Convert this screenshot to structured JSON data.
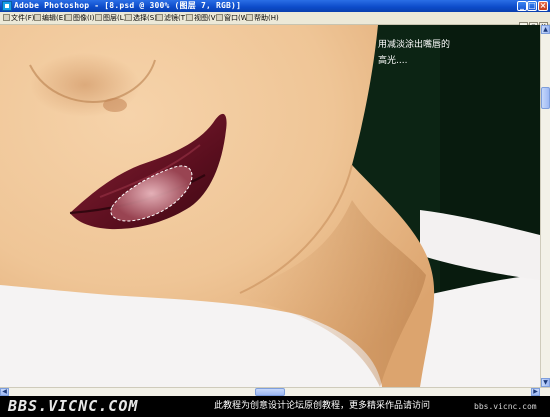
{
  "window": {
    "title": "Adobe Photoshop - [8.psd @ 300% (图层 7, RGB)]",
    "app_icon": "photoshop-icon",
    "controls": [
      "minimize",
      "maximize",
      "close"
    ]
  },
  "menubar": {
    "items": [
      {
        "label": "文件(F)"
      },
      {
        "label": "编辑(E)"
      },
      {
        "label": "图像(I)"
      },
      {
        "label": "图层(L)"
      },
      {
        "label": "选择(S)"
      },
      {
        "label": "滤镜(T)"
      },
      {
        "label": "视图(V)"
      },
      {
        "label": "窗口(W)"
      },
      {
        "label": "帮助(H)"
      }
    ],
    "doc_controls": {
      "minimize": "_",
      "restore": "▫",
      "close": "×"
    }
  },
  "canvas": {
    "caption_line1": "用减淡涂出嘴唇的",
    "caption_line2": "高光....",
    "colors": {
      "skin": "#f0c89a",
      "lip": "#6a1424",
      "background": "#0c2414",
      "shirt": "#f6f4f4"
    }
  },
  "scrollbars": {
    "up": "▲",
    "down": "▼",
    "left": "◀",
    "right": "▶"
  },
  "footer": {
    "logo": "BBS.VICNC.COM",
    "text": "此教程为创意设计论坛原创教程，更多精采作品请访问",
    "site": "bbs.vicnc.com"
  }
}
